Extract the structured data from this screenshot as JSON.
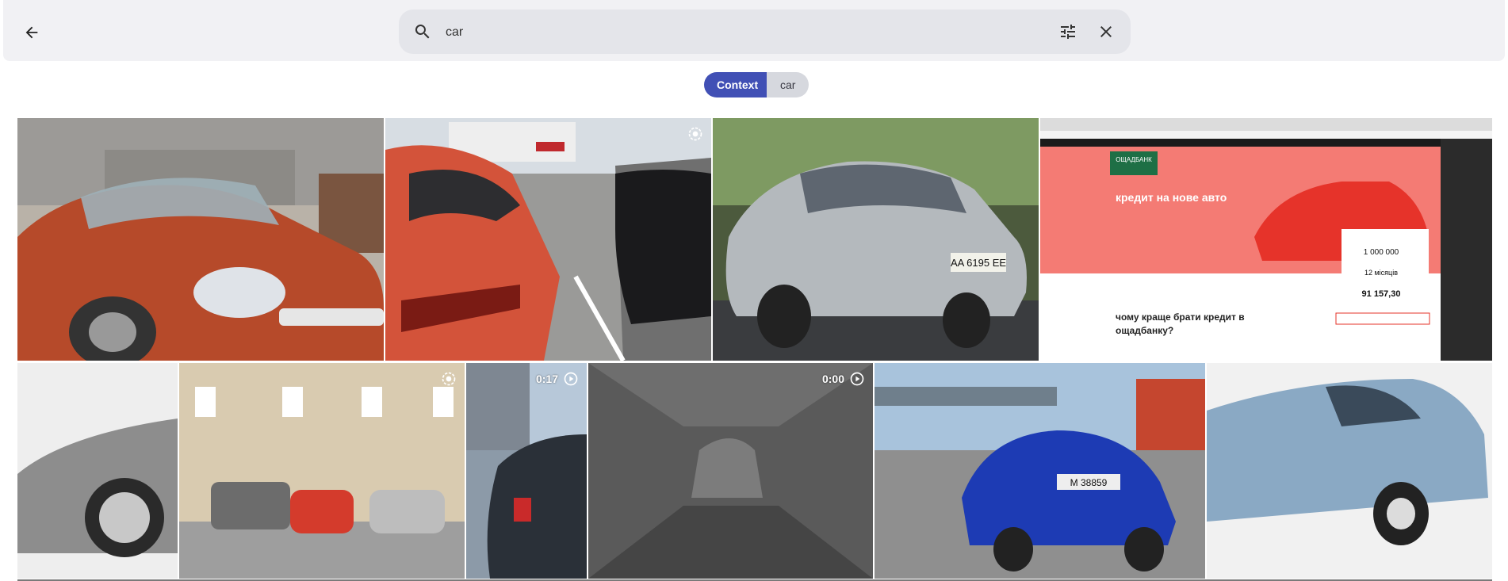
{
  "search": {
    "value": "car",
    "placeholder": ""
  },
  "filters": {
    "context_label": "Context",
    "term_label": "car"
  },
  "colors": {
    "topbar": "#f1f1f4",
    "search_bg": "#e4e5ea",
    "chip_active": "#4150b5",
    "chip_inactive": "#d6d8de"
  },
  "icons": {
    "back": "arrow-left-icon",
    "search": "search-icon",
    "tune": "tune-icon",
    "clear": "close-icon",
    "motion": "motion-photo-icon",
    "play": "play-circle-icon"
  },
  "results": [
    {
      "kind": "photo",
      "subject": "red convertible"
    },
    {
      "kind": "motion_photo",
      "subject": "red hatchback in parking lot"
    },
    {
      "kind": "photo",
      "subject": "silver sedan",
      "plate": "AA 6195 EE"
    },
    {
      "kind": "screenshot",
      "subject": "Oschadbank car loan page",
      "bank": "ОЩАДБАНК",
      "headline": "кредит на нове авто",
      "subhead": "чому краще брати кредит в ощадбанку?",
      "amount": "1 000 000",
      "months": "12 місяців",
      "payment": "91 157,30"
    },
    {
      "kind": "photo",
      "subject": "grey car front wheel"
    },
    {
      "kind": "motion_photo",
      "subject": "cars parked by building"
    },
    {
      "kind": "video",
      "duration": "0:17",
      "subject": "car at roadside"
    },
    {
      "kind": "video",
      "duration": "0:00",
      "subject": "car in tunnel"
    },
    {
      "kind": "photo",
      "subject": "blue sedan on road",
      "plate": "M 38859"
    },
    {
      "kind": "photo",
      "subject": "light blue hatchback"
    }
  ]
}
